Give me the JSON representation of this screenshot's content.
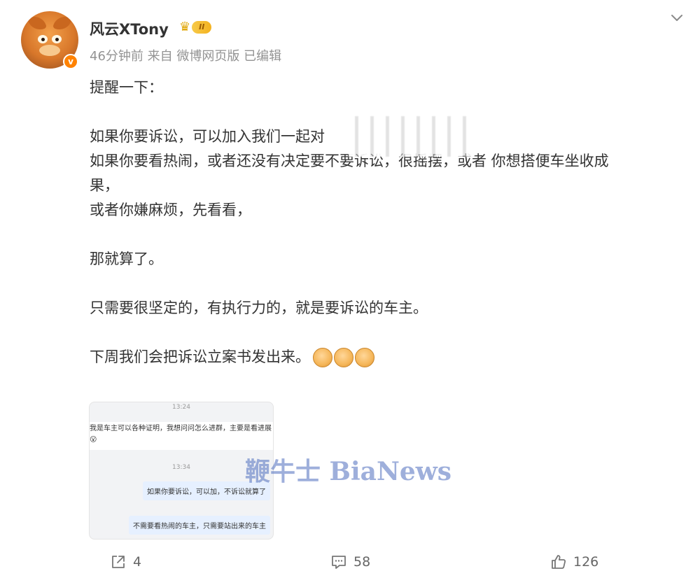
{
  "post": {
    "username": "风云XTony",
    "rank_label": "II",
    "verified_mark": "v",
    "meta": "46分钟前 来自 微博网页版 已编辑",
    "lines": [
      "提醒一下：",
      "",
      "如果你要诉讼，可以加入我们一起对",
      "如果你要看热闹，或者还没有决定要不要诉讼，很摇摆，或者 你想搭便车坐收成",
      "果，",
      "或者你嫌麻烦，先看看，",
      "",
      "那就算了。",
      "",
      "只需要很坚定的，有执行力的，就是要诉讼的车主。",
      "",
      "下周我们会把诉讼立案书发出来。"
    ],
    "emoji": [
      "fist-emoji",
      "fist-emoji",
      "fist-emoji"
    ]
  },
  "attachment": {
    "time1": "13:24",
    "message1": "我是车主可以各种证明，我想问问怎么进群，主要是看进展😮",
    "time2": "13:34",
    "reply1": "如果你要诉讼，可以加，不诉讼就算了",
    "reply2": "不需要看热闹的车主，只需要站出来的车主",
    "watermark": "鞭牛士 BiaNews"
  },
  "actions": {
    "share_count": "4",
    "comment_count": "58",
    "like_count": "126"
  },
  "icons": {
    "more": "chevron-down-icon",
    "share": "share-icon",
    "comment": "comment-icon",
    "like": "thumbs-up-icon"
  }
}
